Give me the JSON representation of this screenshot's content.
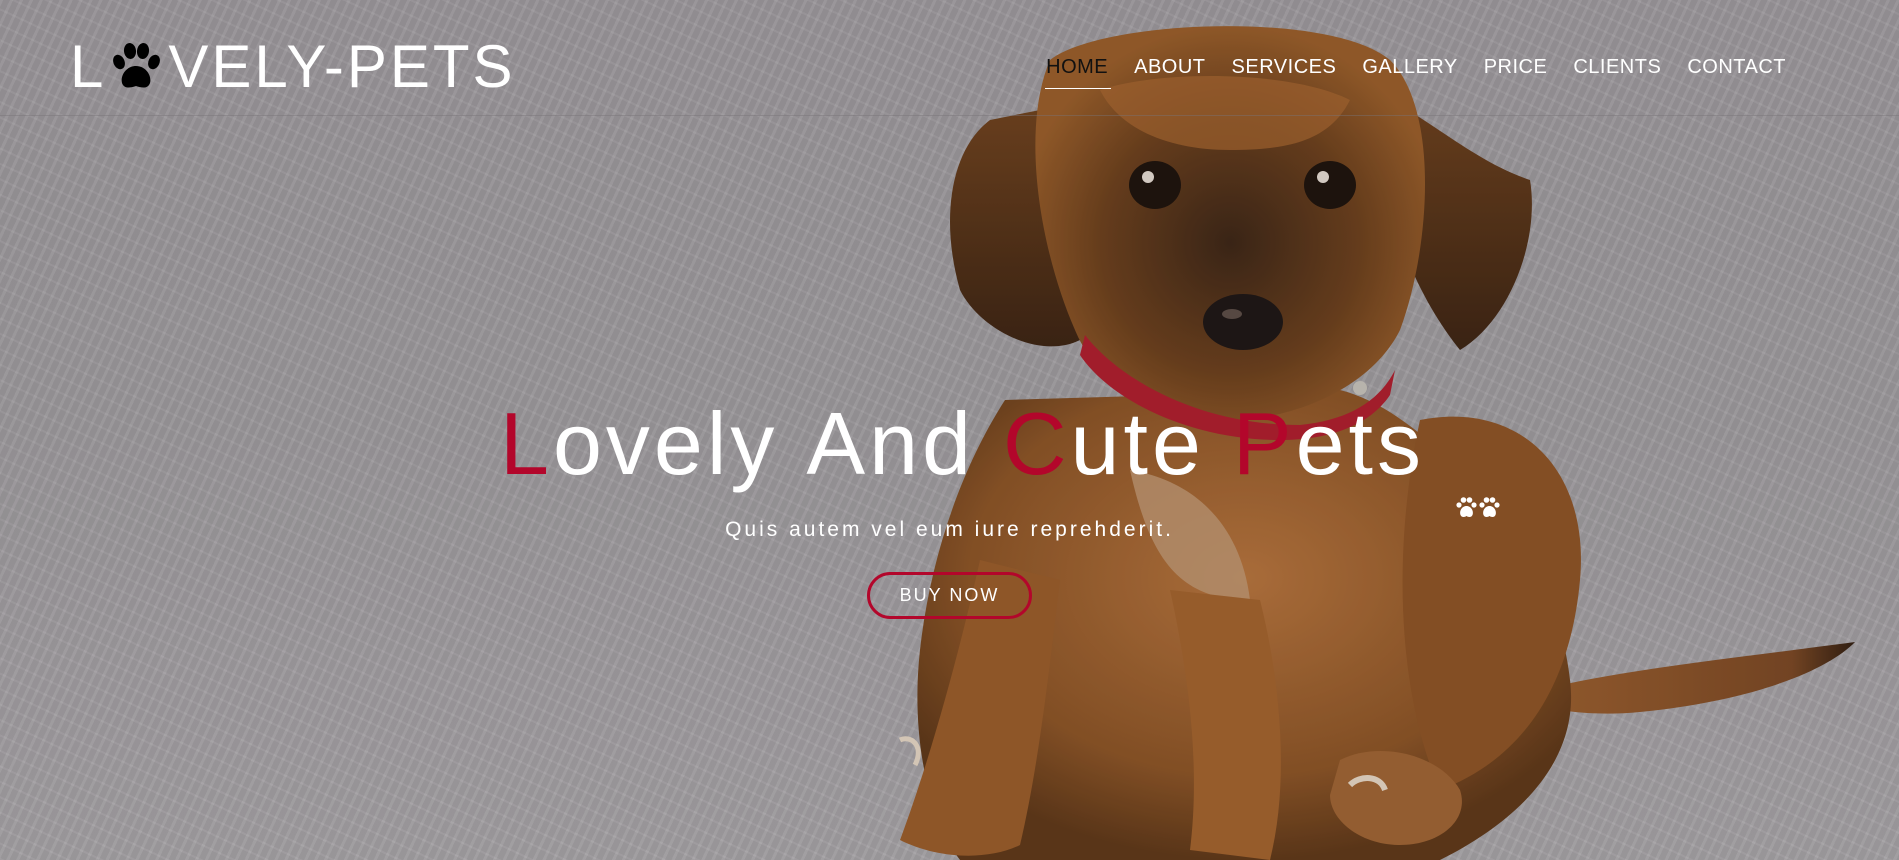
{
  "brand": {
    "logo_before": "L",
    "logo_after": "VELY-PETS"
  },
  "nav": {
    "items": [
      {
        "label": "HOME",
        "active": true
      },
      {
        "label": "ABOUT"
      },
      {
        "label": "SERVICES"
      },
      {
        "label": "GALLERY"
      },
      {
        "label": "PRICE"
      },
      {
        "label": "CLIENTS"
      },
      {
        "label": "CONTACT"
      }
    ]
  },
  "hero": {
    "title": {
      "w1_first": "L",
      "w1_rest": "ovely",
      "w2": "And",
      "w3_first": "C",
      "w3_rest": "ute",
      "w4_first": "P",
      "w4_rest": "ets"
    },
    "subtitle": "Quis autem vel eum iure reprehderit.",
    "cta_label": "BUY NOW"
  },
  "icons": {
    "logo_icon": "paw-icon",
    "title_icon": "double-paw-icon",
    "hero_image": "puppy-photo"
  },
  "colors": {
    "accent": "#b3062b",
    "text": "#ffffff",
    "active_nav": "#111111"
  }
}
